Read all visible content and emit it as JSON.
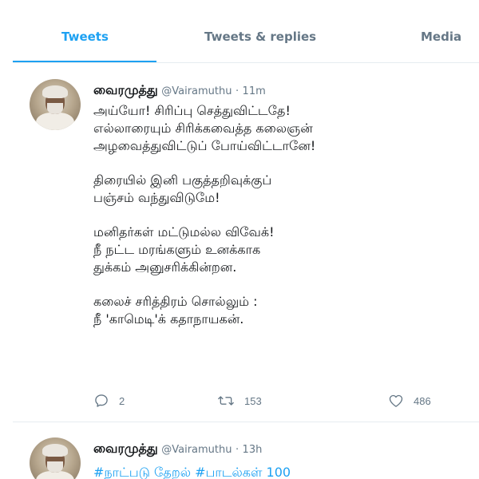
{
  "tabs": {
    "tweets": "Tweets",
    "replies": "Tweets & replies",
    "media": "Media",
    "active": "Tweets"
  },
  "colors": {
    "accent": "#1da1f2",
    "secondary_text": "#657786",
    "primary_text": "#14171a",
    "border": "#e6ecf0"
  },
  "tweets": [
    {
      "name": "வைரமுத்து",
      "handle": "@Vairamuthu",
      "separator": "·",
      "time": "11m",
      "body": [
        [
          "அய்யோ! சிரிப்பு செத்துவிட்டதே!",
          "எல்லாரையும் சிரிக்கவைத்த கலைஞன்",
          "அழவைத்துவிட்டுப் போய்விட்டானே!"
        ],
        [
          "திரையில் இனி பகுத்தறிவுக்குப்",
          "பஞ்சம் வந்துவிடுமே!"
        ],
        [
          "மனிதர்கள் மட்டுமல்ல விவேக்!",
          "நீ நட்ட மரங்களும் உனக்காக",
          "துக்கம் அனுசரிக்கின்றன."
        ],
        [
          "கலைச் சரித்திரம் சொல்லும் :",
          "நீ 'காமெடி'க்  கதாநாயகன்."
        ]
      ],
      "actions": {
        "reply_icon": "reply-icon",
        "reply_count": "2",
        "retweet_icon": "retweet-icon",
        "retweet_count": "153",
        "like_icon": "heart-icon",
        "like_count": "486"
      }
    },
    {
      "name": "வைரமுத்து",
      "handle": "@Vairamuthu",
      "separator": "·",
      "time": "13h",
      "hashtags": [
        "#நாட்படு தேறல்",
        "#பாடல்கள் 100"
      ]
    }
  ]
}
